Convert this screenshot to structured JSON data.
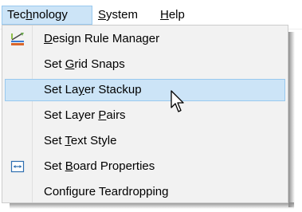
{
  "menubar": {
    "items": [
      {
        "label_pre": "Tec",
        "label_acc": "h",
        "label_post": "nology",
        "active": true
      },
      {
        "label_pre": "",
        "label_acc": "S",
        "label_post": "ystem",
        "active": false
      },
      {
        "label_pre": "",
        "label_acc": "H",
        "label_post": "elp",
        "active": false
      }
    ]
  },
  "technology_menu": {
    "items": [
      {
        "label_pre": "",
        "label_acc": "D",
        "label_post": "esign Rule Manager",
        "icon": "design-rule-manager-icon"
      },
      {
        "label_pre": "Set ",
        "label_acc": "G",
        "label_post": "rid Snaps",
        "icon": null
      },
      {
        "label_pre": "Set La",
        "label_acc": "y",
        "label_post": "er Stackup",
        "icon": null,
        "highlighted": true
      },
      {
        "label_pre": "Set Layer ",
        "label_acc": "P",
        "label_post": "airs",
        "icon": null
      },
      {
        "label_pre": "Set ",
        "label_acc": "T",
        "label_post": "ext Style",
        "icon": null
      },
      {
        "label_pre": "Set ",
        "label_acc": "B",
        "label_post": "oard Properties",
        "icon": "board-properties-icon"
      },
      {
        "label_pre": "Configure Teardroppin",
        "label_acc": "g",
        "label_post": "",
        "icon": null
      }
    ]
  },
  "colors": {
    "highlight_fill": "#cce4f7",
    "highlight_border": "#99c9ef",
    "menu_background": "#f2f2f2"
  }
}
